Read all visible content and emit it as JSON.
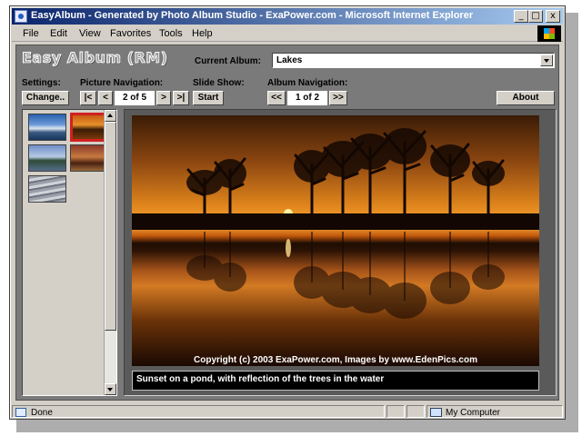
{
  "window": {
    "title": "EasyAlbum - Generated by Photo Album Studio - ExaPower.com - Microsoft Internet Explorer",
    "min": "_",
    "max": "□",
    "close": "x"
  },
  "menu": [
    "File",
    "Edit",
    "View",
    "Favorites",
    "Tools",
    "Help"
  ],
  "app": {
    "logo": "Easy Album (RM)",
    "current_album_label": "Current Album:",
    "current_album_value": "Lakes",
    "settings_label": "Settings:",
    "change_button": "Change..",
    "picture_nav_label": "Picture Navigation:",
    "first_button": "|<",
    "prev_button": "<",
    "picture_position": "2 of 5",
    "next_button": ">",
    "last_button": ">|",
    "slideshow_label": "Slide Show:",
    "start_button": "Start",
    "album_nav_label": "Album Navigation:",
    "album_prev_button": "<<",
    "album_position": "1 of 2",
    "album_next_button": ">>",
    "about_button": "About"
  },
  "thumbnails": [
    {
      "name": "thumbnail-1",
      "selected": false
    },
    {
      "name": "thumbnail-2",
      "selected": true
    },
    {
      "name": "thumbnail-3",
      "selected": false
    },
    {
      "name": "thumbnail-4",
      "selected": false
    },
    {
      "name": "thumbnail-5",
      "selected": false
    }
  ],
  "photo": {
    "copyright": "Copyright (c) 2003 ExaPower.com, Images by www.EdenPics.com",
    "caption": "Sunset on a pond, with reflection of the trees in the water"
  },
  "status": {
    "text": "Done",
    "zone": "My Computer"
  }
}
